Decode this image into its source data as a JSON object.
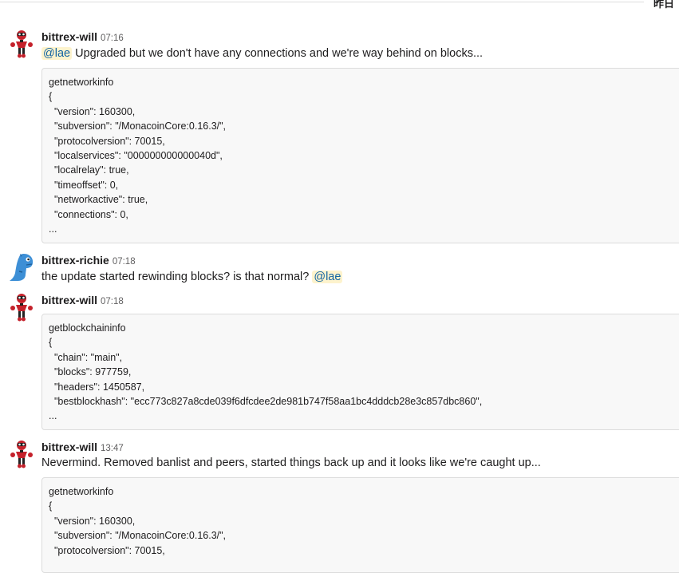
{
  "day_divider": {
    "label": "昨日"
  },
  "messages": [
    {
      "author": "bittrex-will",
      "time": "07:16",
      "avatar": "robot-avatar-icon",
      "text_parts": {
        "mention": "@lae",
        "body": " Upgraded but we don't have any connections and we're way behind on blocks..."
      },
      "code_lines": [
        "getnetworkinfo",
        "{",
        "  \"version\": 160300,",
        "  \"subversion\": \"/MonacoinCore:0.16.3/\",",
        "  \"protocolversion\": 70015,",
        "  \"localservices\": \"000000000000040d\",",
        "  \"localrelay\": true,",
        "  \"timeoffset\": 0,",
        "  \"networkactive\": true,",
        "  \"connections\": 0,",
        "..."
      ]
    },
    {
      "author": "bittrex-richie",
      "time": "07:18",
      "avatar": "blue-dinosaur-avatar-icon",
      "text_parts": {
        "body": "the update started rewinding blocks?  is that normal? ",
        "mention": "@lae"
      }
    },
    {
      "author": "bittrex-will",
      "time": "07:18",
      "avatar": "robot-avatar-icon",
      "code_lines": [
        "getblockchaininfo",
        "{",
        "  \"chain\": \"main\",",
        "  \"blocks\": 977759,",
        "  \"headers\": 1450587,",
        "  \"bestblockhash\": \"ecc773c827a8cde039f6dfcdee2de981b747f58aa1bc4dddcb28e3c857dbc860\",",
        "..."
      ]
    },
    {
      "author": "bittrex-will",
      "time": "13:47",
      "avatar": "robot-avatar-icon",
      "text_parts": {
        "body": "Nevermind. Removed banlist and peers, started things back up and it looks like we're caught up..."
      },
      "code_lines": [
        "getnetworkinfo",
        "{",
        "  \"version\": 160300,",
        "  \"subversion\": \"/MonacoinCore:0.16.3/\",",
        "  \"protocolversion\": 70015,"
      ]
    }
  ]
}
